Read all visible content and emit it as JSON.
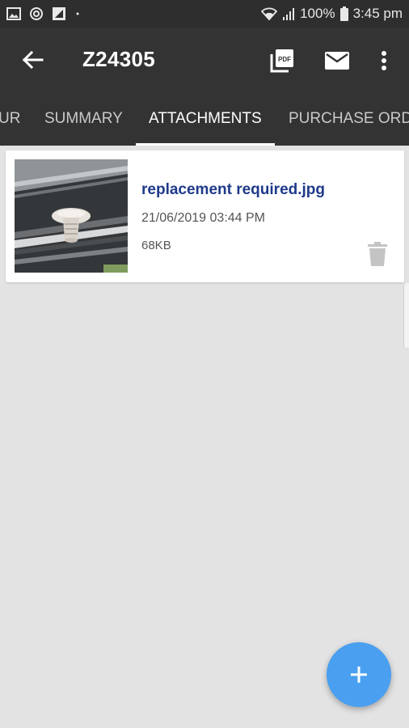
{
  "status_bar": {
    "battery": "100%",
    "time": "3:45 pm",
    "icons": [
      "image-icon",
      "sync-icon",
      "app-icon",
      "dot-icon",
      "wifi-icon",
      "signal-icon",
      "battery-icon"
    ]
  },
  "app_bar": {
    "title": "Z24305",
    "icons": [
      "back-arrow-icon",
      "pdf-icon",
      "mail-icon",
      "more-vert-icon"
    ]
  },
  "tabs": [
    {
      "label": "UR",
      "active": false
    },
    {
      "label": "SUMMARY",
      "active": false
    },
    {
      "label": "ATTACHMENTS",
      "active": true
    },
    {
      "label": "PURCHASE ORDE",
      "active": false
    }
  ],
  "attachments": [
    {
      "filename": "replacement required.jpg",
      "date": "21/06/2019 03:44 PM",
      "size": "68KB"
    }
  ],
  "fab": {
    "icon": "plus-icon"
  },
  "colors": {
    "app_bar": "#333333",
    "status_bar": "#2e2e2e",
    "background": "#e3e3e3",
    "filename": "#1f3a8a",
    "fab": "#4a9ff0"
  }
}
